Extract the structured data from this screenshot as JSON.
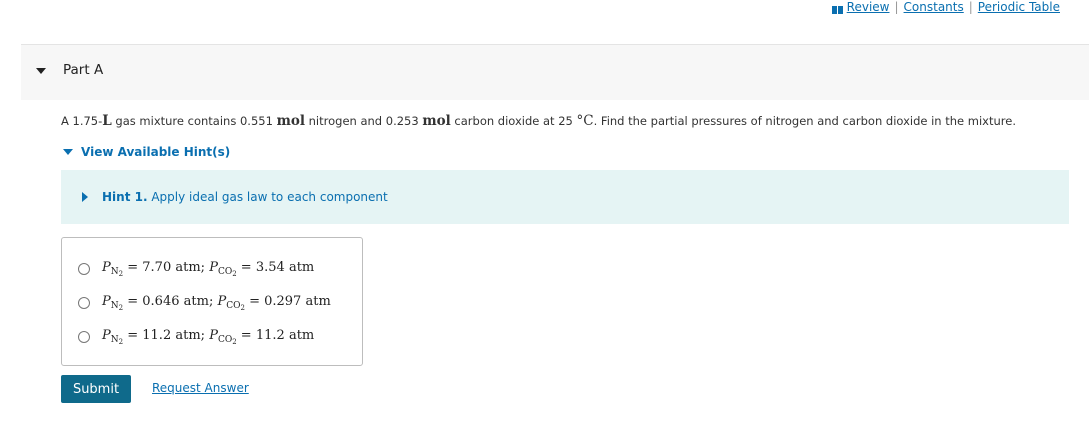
{
  "top_links": {
    "icon": "book-icon",
    "review": "Review",
    "separator": "|",
    "constants": "Constants",
    "periodic_table": "Periodic Table"
  },
  "part": {
    "title": "Part A"
  },
  "question": {
    "t1": "A 1.75-",
    "unit_L": "L",
    "t2": " gas mixture contains 0.551 ",
    "mol1": "mol",
    "t3": " nitrogen and 0.253 ",
    "mol2": "mol",
    "t4": " carbon dioxide at 25 ",
    "degC": "°C",
    "t5": ". Find the partial pressures of nitrogen and carbon dioxide in the mixture."
  },
  "hints": {
    "toggle_label": "View Available Hint(s)",
    "items": [
      {
        "number_label": "Hint 1.",
        "text": " Apply ideal gas law to each component"
      }
    ]
  },
  "choices": [
    {
      "pn2": "7.70",
      "pco2": "3.54",
      "unit": "atm"
    },
    {
      "pn2": "0.646",
      "pco2": "0.297",
      "unit": "atm"
    },
    {
      "pn2": "11.2",
      "pco2": "11.2",
      "unit": "atm"
    }
  ],
  "symbols": {
    "P": "P",
    "N": "N",
    "two": "2",
    "CO": "CO",
    "equals": " = ",
    "sep": "; "
  },
  "actions": {
    "submit": "Submit",
    "request_answer": "Request Answer"
  },
  "colors": {
    "link": "#0a6fb0",
    "submit_bg": "#0f6a8b",
    "hint_bg": "#e5f4f4",
    "header_bg": "#f7f7f7"
  }
}
